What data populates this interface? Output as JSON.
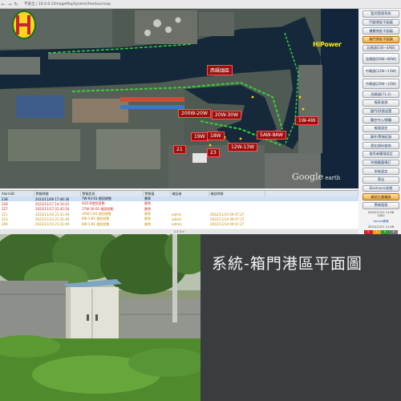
{
  "browser": {
    "url": "不安全 | 10.0.0.1/ImageMapSystem/Harbourmap",
    "back_glyph": "←",
    "forward_glyph": "→",
    "reload_glyph": "↻"
  },
  "logo": {
    "brand": "HiPower",
    "icon": "hipower-logo-icon"
  },
  "map": {
    "watermark_main": "Google",
    "watermark_sub": " earth",
    "labels": [
      {
        "id": "seawall",
        "text": "西碼頭區"
      },
      {
        "id": "w200",
        "text": "200W-20W"
      },
      {
        "id": "w20",
        "text": "20W-30W"
      },
      {
        "id": "w1",
        "text": "1W-4W"
      },
      {
        "id": "s19",
        "text": "19W"
      },
      {
        "id": "s18",
        "text": "18W"
      },
      {
        "id": "w5a",
        "text": "5AW-8AW"
      },
      {
        "id": "w12",
        "text": "12W-13W"
      },
      {
        "id": "s21",
        "text": "21"
      },
      {
        "id": "s23",
        "text": "23"
      }
    ]
  },
  "sidebar": {
    "items": [
      {
        "label": "監控管理系統",
        "active": false
      },
      {
        "label": "門號港區平面圖",
        "active": false
      },
      {
        "label": "樓層港區平面圖",
        "active": false
      },
      {
        "label": "箱門港區平面圖",
        "active": true
      },
      {
        "label": "北碼頭(1W~4AW)",
        "active": false,
        "tall": false
      },
      {
        "label": "北碼頭(5AW~8AW)",
        "active": false,
        "tall": true
      },
      {
        "label": "中碼頭(12W~13W)",
        "active": false,
        "tall": true
      },
      {
        "label": "中碼頭(20W~33W)",
        "active": false,
        "tall": true
      },
      {
        "label": "西碼頭(71-2)",
        "active": false
      },
      {
        "label": "報表查詢",
        "active": false
      },
      {
        "label": "盤門/狀態設置",
        "active": false
      },
      {
        "label": "電控中心/標籤",
        "active": false
      },
      {
        "label": "帳號設定",
        "active": false
      },
      {
        "label": "事件/警報紀錄",
        "active": false
      },
      {
        "label": "歷史資料查詢",
        "active": false
      },
      {
        "label": "使用者權限設定",
        "active": false
      },
      {
        "label": "時間電腦預訂",
        "active": false
      },
      {
        "label": "系統設定",
        "active": false
      },
      {
        "label": "登出",
        "active": false
      },
      {
        "label": "Electronic狀態",
        "active": false
      },
      {
        "label": "確認主盤電路",
        "active": false
      },
      {
        "label": "警報管理",
        "active": false
      }
    ],
    "meta_line1": "2022/11/21 11:08",
    "meta_line2": "1000",
    "user": "Server帳號",
    "meta_line3": "2022/11/21 11:08",
    "status": [
      {
        "label": "0",
        "color": "#d62020"
      },
      {
        "label": "1",
        "color": "#e8a317"
      },
      {
        "label": "0",
        "color": "#2e9c2e"
      },
      {
        "label": "0",
        "color": "#777777"
      }
    ]
  },
  "alarm_table": {
    "headers": [
      "AlarmID",
      "警報時間",
      "警報訊息",
      "警報值",
      "確認者",
      "確認時間"
    ],
    "rows": [
      {
        "cls": "sel",
        "cells": [
          "238",
          "2022/11/09 17:46:30",
          "7W-93-01-燈訊狀態",
          "異常",
          "",
          ""
        ]
      },
      {
        "cls": "crit",
        "cells": [
          "228",
          "2022/11/17 14:10:22",
          "H10-D燈訊狀態",
          "異常",
          "",
          ""
        ]
      },
      {
        "cls": "crit",
        "cells": [
          "227",
          "2022/11/17 01:42:54",
          "17W-30-01-燈訊狀態",
          "異常",
          "",
          ""
        ]
      },
      {
        "cls": "warn",
        "cells": [
          "211",
          "2022/11/19 21:31:49",
          "20W-1-B1-燈訊狀態",
          "異常",
          "admin",
          "2022/11/14 09:47:27"
        ]
      },
      {
        "cls": "warn",
        "cells": [
          "210",
          "2022/11/14 21:31:49",
          "9W-1-B1-燈訊狀態",
          "異常",
          "admin",
          "2022/11/14 09:47:27"
        ]
      },
      {
        "cls": "warn",
        "cells": [
          "209",
          "2022/11/14 21:31:49",
          "8W-1-B1-燈訊狀態",
          "異常",
          "admin",
          "2022/11/14 09:47:27"
        ]
      }
    ],
    "pager": "1  2  3  >"
  },
  "caption": "系統-箱門港區平面圖"
}
